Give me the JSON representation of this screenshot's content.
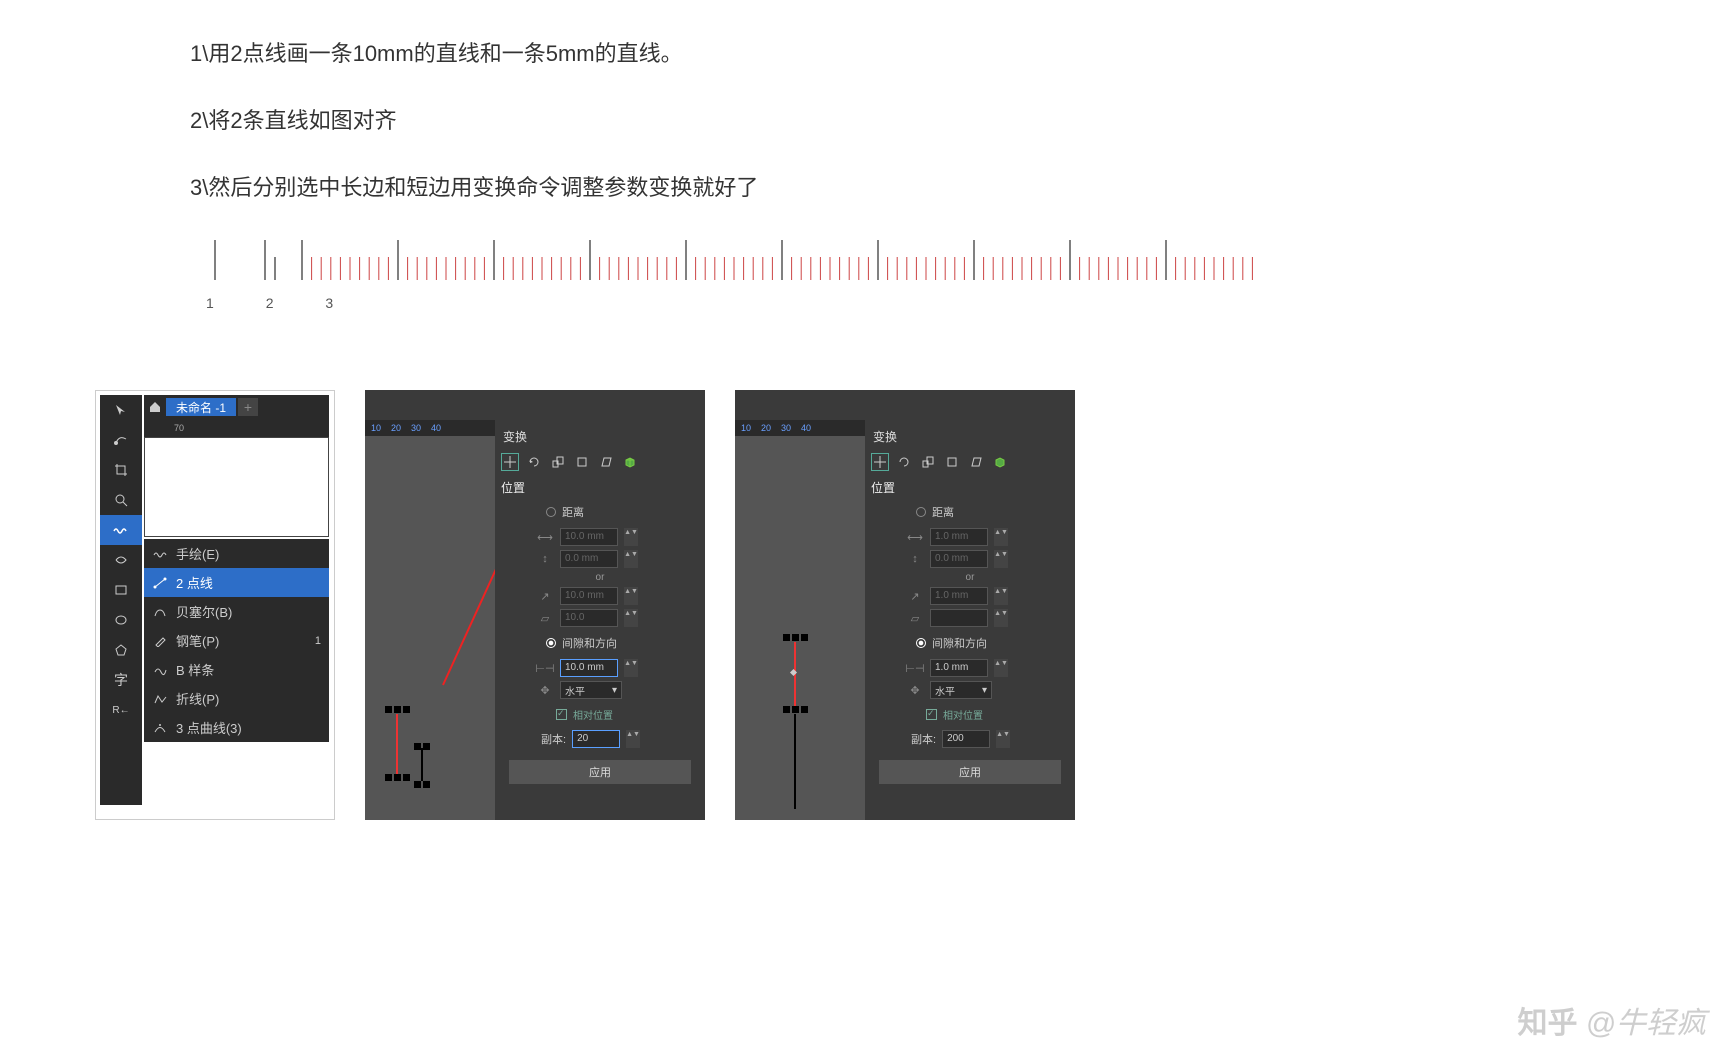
{
  "instructions": {
    "step1": "1\\用2点线画一条10mm的直线和一条5mm的直线。",
    "step2": "2\\将2条直线如图对齐",
    "step3": "3\\然后分别选中长边和短边用变换命令调整参数变换就好了"
  },
  "ruler_labels": {
    "l1": "1",
    "l2": "2",
    "l3": "3"
  },
  "toolbox": {
    "tab_title": "未命名 -1",
    "ruler_mark": "70",
    "flyout": {
      "freehand": "手绘(E)",
      "two_point": "2 点线",
      "bezier": "贝塞尔(B)",
      "pen": "钢笔(P)",
      "pen_shortcut": "1",
      "bspline": "B 样条",
      "polyline": "折线(P)",
      "three_pt_curve": "3 点曲线(3)"
    },
    "text_tool": "字"
  },
  "transform": {
    "title": "变换",
    "position_label": "位置",
    "distance_label": "距离",
    "gap_dir_label": "间隙和方向",
    "or": "or",
    "h_val_disabled": "10.0 mm",
    "v_val_disabled": "0.0 mm",
    "diag_val": "10.0 mm",
    "rect_val": "10.0",
    "gap_val_a": "10.0 mm",
    "gap_val_b": "1.0 mm",
    "direction": "水平",
    "relative": "相对位置",
    "copies_label": "副本:",
    "copies_a": "20",
    "copies_b": "200",
    "apply": "应用",
    "ruler_ticks": [
      "10",
      "20",
      "30",
      "40"
    ]
  },
  "watermark": {
    "logo": "知乎",
    "at": "@牛轻疯"
  }
}
